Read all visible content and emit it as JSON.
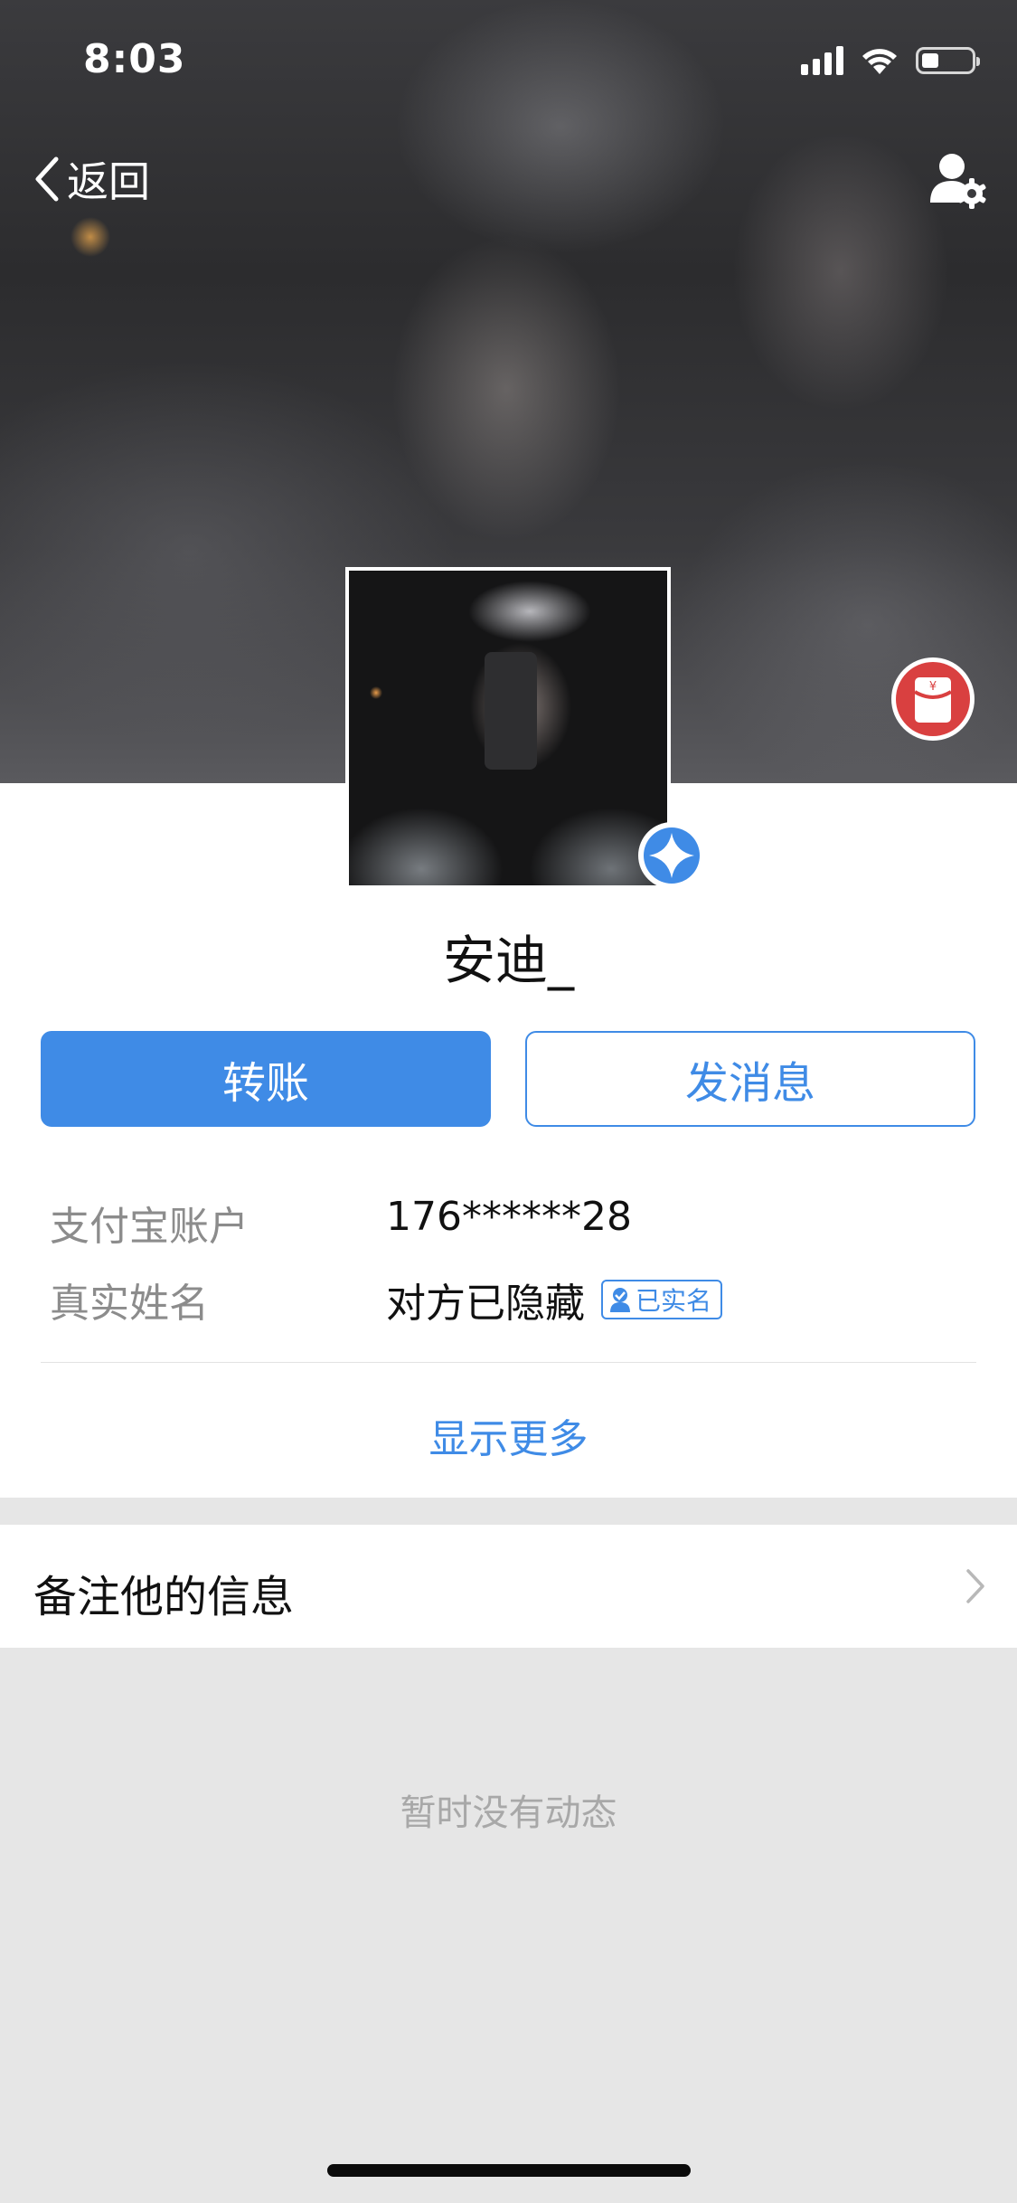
{
  "status_bar": {
    "time": "8:03",
    "battery_level": 0.3
  },
  "nav": {
    "back_label": "返回"
  },
  "profile": {
    "nickname": "安迪_"
  },
  "actions": {
    "transfer_label": "转账",
    "message_label": "发消息"
  },
  "info": {
    "account_label": "支付宝账户",
    "account_value": "176******28",
    "realname_label": "真实姓名",
    "realname_value": "对方已隐藏",
    "verified_label": "已实名"
  },
  "show_more_label": "显示更多",
  "remark_label": "备注他的信息",
  "empty_feed_text": "暂时没有动态",
  "colors": {
    "accent": "#3f8be6",
    "redpacket": "#d94040"
  }
}
